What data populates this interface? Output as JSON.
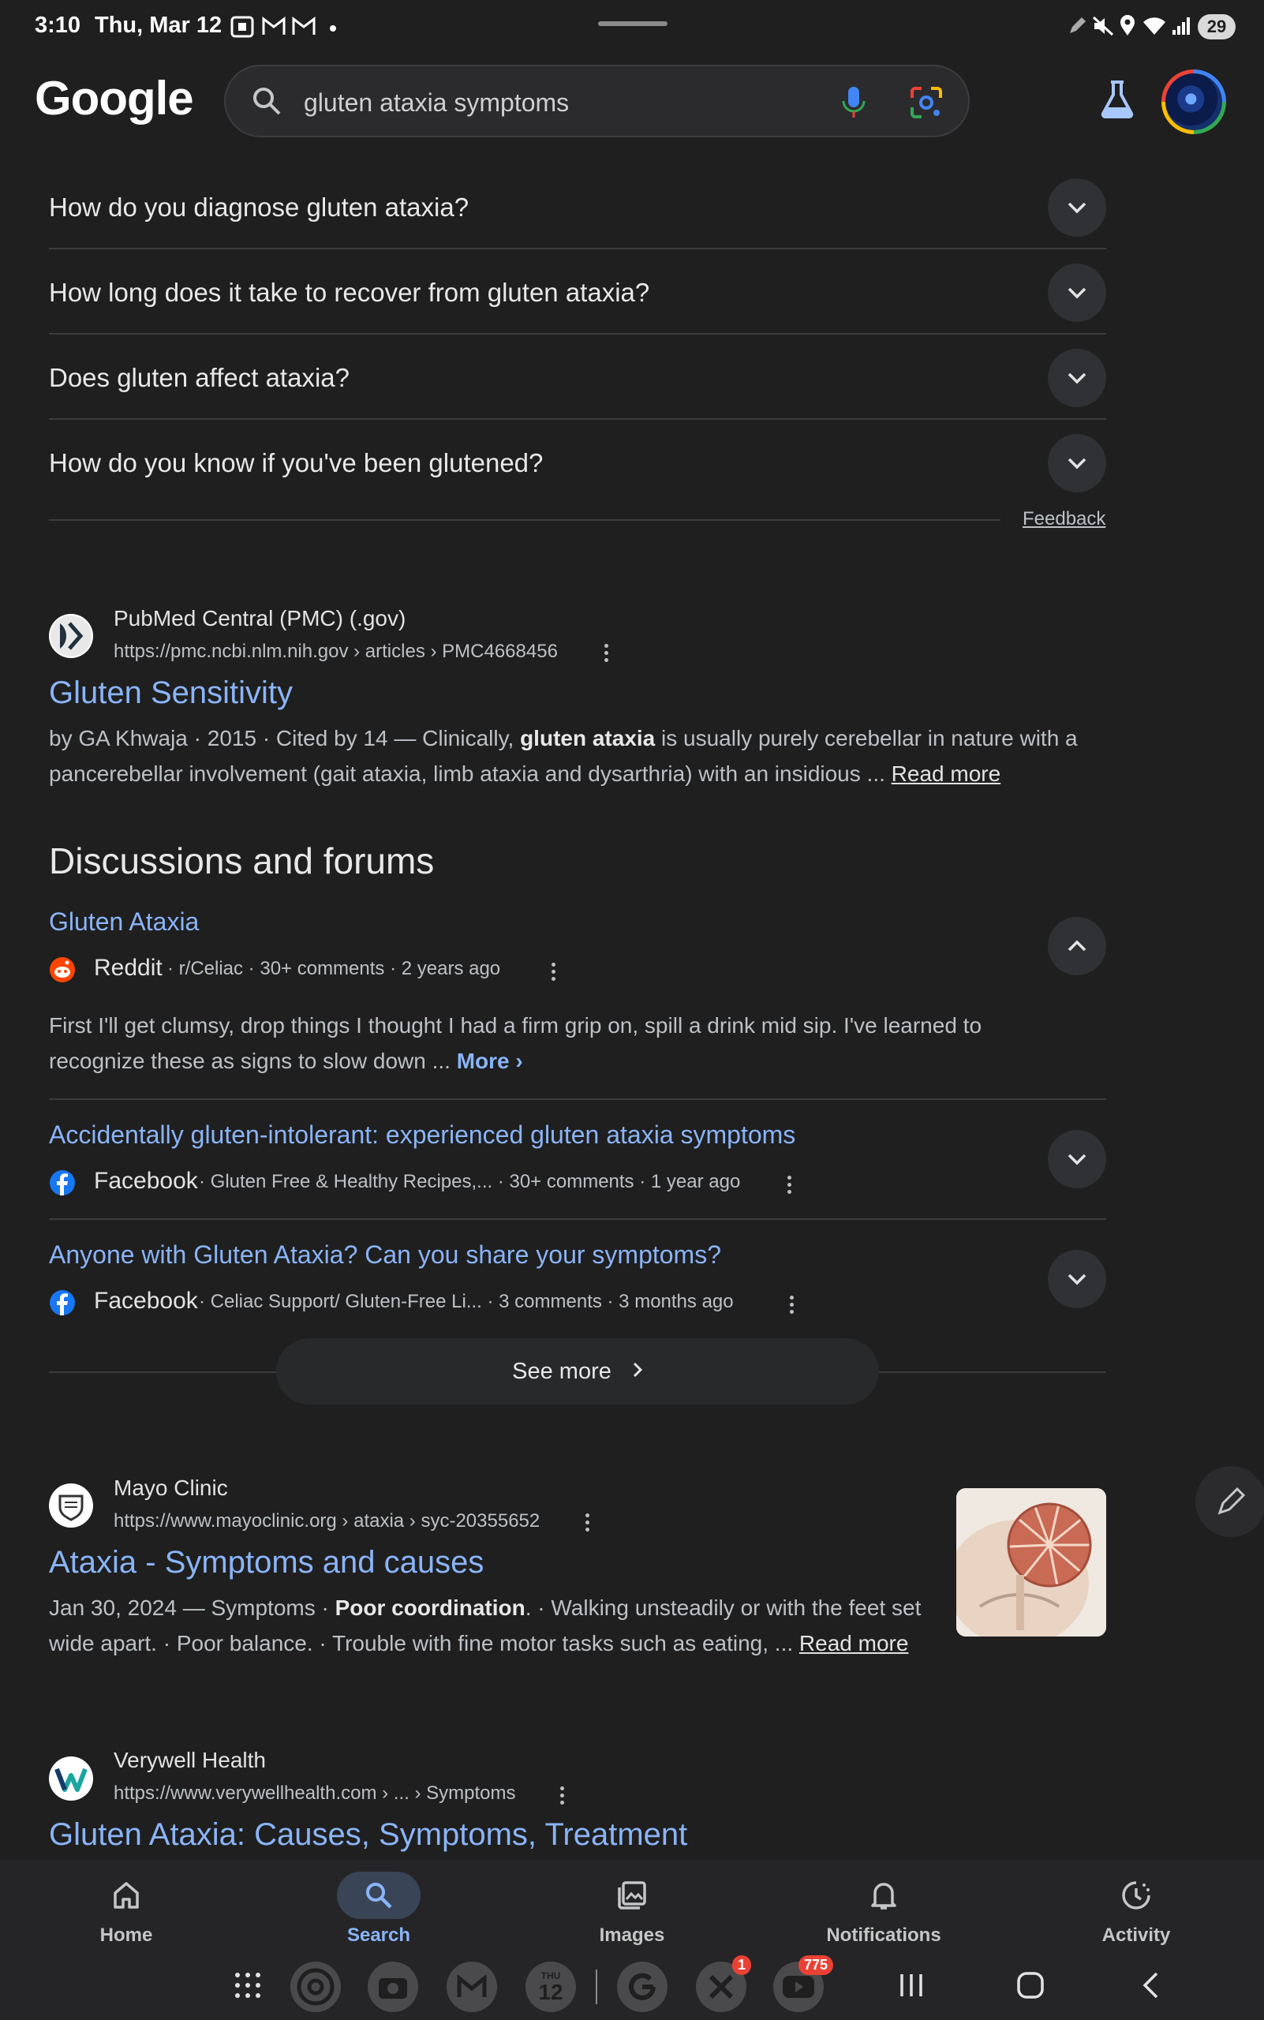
{
  "status_bar": {
    "time": "3:10",
    "date": "Thu, Mar 12",
    "battery": "29"
  },
  "header": {
    "logo": "Google",
    "search_query": "gluten ataxia symptoms"
  },
  "people_also_ask": {
    "questions": [
      "How do you diagnose gluten ataxia?",
      "How long does it take to recover from gluten ataxia?",
      "Does gluten affect ataxia?",
      "How do you know if you've been glutened?"
    ],
    "feedback": "Feedback"
  },
  "result_pmc": {
    "site": "PubMed Central (PMC) (.gov)",
    "url": "https://pmc.ncbi.nlm.nih.gov › articles › PMC4668456",
    "title": "Gluten Sensitivity",
    "snippet_pre": "by GA Khwaja · 2015 · Cited by 14 — Clinically, ",
    "snippet_bold": "gluten ataxia",
    "snippet_post": " is usually purely cerebellar in nature with a pancerebellar involvement (gait ataxia, limb ataxia and dysarthria) with an insidious ... ",
    "read_more": "Read more"
  },
  "discussions": {
    "heading": "Discussions and forums",
    "items": [
      {
        "title": "Gluten Ataxia",
        "source": "Reddit",
        "meta": "· r/Celiac · 30+ comments · 2 years ago",
        "excerpt": "First I'll get clumsy, drop things I thought I had a firm grip on, spill a drink mid sip. I've learned to recognize these as signs to slow down ... ",
        "more": "More"
      },
      {
        "title": "Accidentally gluten-intolerant: experienced gluten ataxia symptoms",
        "source": "Facebook",
        "meta": "· Gluten Free & Healthy Recipes,... · 30+ comments · 1 year ago"
      },
      {
        "title": "Anyone with Gluten Ataxia? Can you share your symptoms?",
        "source": "Facebook",
        "meta": "· Celiac Support/ Gluten-Free Li... · 3 comments · 3 months ago"
      }
    ],
    "see_more": "See more"
  },
  "result_mayo": {
    "site": "Mayo Clinic",
    "url": "https://www.mayoclinic.org › ataxia › syc-20355652",
    "title": "Ataxia - Symptoms and causes",
    "snippet_pre": "Jan 30, 2024 — Symptoms · ",
    "snippet_bold": "Poor coordination",
    "snippet_post": ". · Walking unsteadily or with the feet set wide apart. · Poor balance. · Trouble with fine motor tasks such as eating, ... ",
    "read_more": "Read more"
  },
  "result_verywell": {
    "site": "Verywell Health",
    "url": "https://www.verywellhealth.com › ... › Symptoms",
    "title": "Gluten Ataxia: Causes, Symptoms, Treatment"
  },
  "bottom_nav": {
    "items": [
      {
        "label": "Home",
        "icon": "home-icon"
      },
      {
        "label": "Search",
        "icon": "search-icon",
        "active": true
      },
      {
        "label": "Images",
        "icon": "images-icon"
      },
      {
        "label": "Notifications",
        "icon": "bell-icon"
      },
      {
        "label": "Activity",
        "icon": "activity-icon"
      }
    ]
  },
  "dock": {
    "calendar_day": "THU",
    "calendar_date": "12",
    "x_badge": "1",
    "youtube_badge": "775"
  },
  "colors": {
    "background": "#1f1f1f",
    "link": "#8ab4f8",
    "text": "#e3e3e3",
    "muted": "#bdc1c6"
  }
}
